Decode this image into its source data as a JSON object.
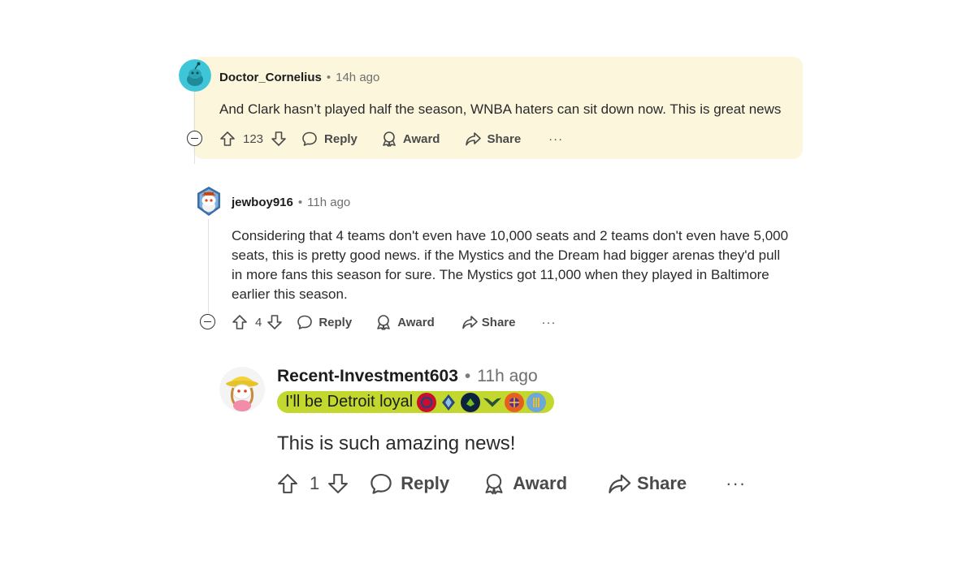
{
  "comments": [
    {
      "username": "Doctor_Cornelius",
      "separator": "•",
      "time": "14h ago",
      "body": "And Clark hasn’t played half the season, WNBA haters can sit down now. This is great news",
      "score": "123",
      "reply_label": "Reply",
      "award_label": "Award",
      "share_label": "Share",
      "more_label": "···"
    },
    {
      "username": "jewboy916",
      "separator": "•",
      "time": "11h ago",
      "body_lines": [
        "Considering that 4 teams don't even have 10,000 seats and 2 teams don't even have 5,000",
        "seats, this is pretty good news. if the Mystics and the Dream had bigger arenas they'd pull",
        "in more fans this season for sure. The Mystics got 11,000 when they played in Baltimore",
        "earlier this season."
      ],
      "score": "4",
      "reply_label": "Reply",
      "award_label": "Award",
      "share_label": "Share",
      "more_label": "···"
    },
    {
      "username": "Recent-Investment603",
      "separator": "•",
      "time": "11h ago",
      "flair_text": "I'll be Detroit loyal",
      "body": "This is such amazing news!",
      "score": "1",
      "reply_label": "Reply",
      "award_label": "Award",
      "share_label": "Share",
      "more_label": "···"
    }
  ],
  "colors": {
    "highlight_bg": "#fcf6dd",
    "flair_bg": "#c2d82e",
    "text": "#1c1c1c",
    "meta": "#6e6e6e"
  },
  "icons": [
    "avatar-snoo-teal",
    "avatar-snoo-hat",
    "avatar-snoo-girl",
    "upvote-icon",
    "downvote-icon",
    "reply-icon",
    "award-icon",
    "share-icon",
    "more-icon",
    "collapse-icon"
  ]
}
